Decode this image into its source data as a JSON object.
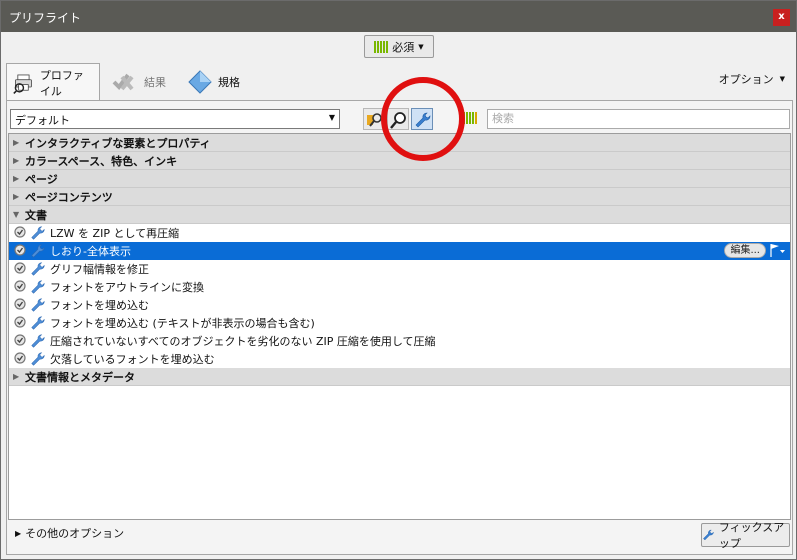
{
  "window": {
    "title": "プリフライト",
    "close_label": "x"
  },
  "toolbar": {
    "required_label": "必須"
  },
  "tabs": [
    {
      "label": "プロファイル",
      "active": true,
      "icon": "printer-magnifier-icon"
    },
    {
      "label": "結果",
      "active": false,
      "icon": "check-marks-icon"
    },
    {
      "label": "規格",
      "active": false,
      "icon": "diamond-icon"
    }
  ],
  "options_label": "オプション",
  "profile_select": {
    "value": "デフォルト"
  },
  "search": {
    "placeholder": "検索"
  },
  "groups": [
    {
      "label": "インタラクティブな要素とプロパティ",
      "expanded": false
    },
    {
      "label": "カラースペース、特色、インキ",
      "expanded": false
    },
    {
      "label": "ページ",
      "expanded": false
    },
    {
      "label": "ページコンテンツ",
      "expanded": false
    },
    {
      "label": "文書",
      "expanded": true
    }
  ],
  "document_items": [
    "LZW を ZIP として再圧縮",
    "しおり-全体表示",
    "グリフ幅情報を修正",
    "フォントをアウトラインに変換",
    "フォントを埋め込む",
    "フォントを埋め込む (テキストが非表示の場合も含む)",
    "圧縮されていないすべてのオブジェクトを劣化のない ZIP 圧縮を使用して圧縮",
    "欠落しているフォントを埋め込む"
  ],
  "selected_item_index": 1,
  "edit_label": "編集...",
  "last_group": {
    "label": "文書情報とメタデータ"
  },
  "bottom": {
    "more_options_label": "その他のオプション",
    "fixup_label": "フィックスアップ"
  },
  "colors": {
    "selection": "#0a6cd6",
    "titlebar": "#5a5a55",
    "annotation_circle": "#e01010",
    "required_bars": "#79b700"
  }
}
